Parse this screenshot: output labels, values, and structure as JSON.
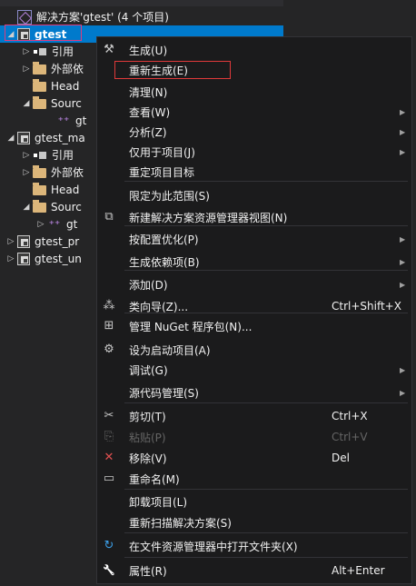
{
  "solution_explorer": {
    "solution": "解决方案'gtest' (4 个项目)",
    "nodes": [
      {
        "label": "gtest",
        "expander": "◢",
        "icon": "project-icon",
        "selected": true
      },
      {
        "label": "引用",
        "expander": "▷",
        "icon": "references-icon"
      },
      {
        "label": "外部依",
        "expander": "▷",
        "icon": "folder-icon"
      },
      {
        "label": "Head",
        "expander": "",
        "icon": "folder-icon"
      },
      {
        "label": "Sourc",
        "expander": "◢",
        "icon": "folder-icon"
      },
      {
        "label": "gt",
        "expander": "",
        "icon": "cpp-file-icon"
      },
      {
        "label": "gtest_ma",
        "expander": "◢",
        "icon": "project-icon"
      },
      {
        "label": "引用",
        "expander": "▷",
        "icon": "references-icon"
      },
      {
        "label": "外部依",
        "expander": "▷",
        "icon": "folder-icon"
      },
      {
        "label": "Head",
        "expander": "",
        "icon": "folder-icon"
      },
      {
        "label": "Sourc",
        "expander": "◢",
        "icon": "folder-icon"
      },
      {
        "label": "gt",
        "expander": "▷",
        "icon": "cpp-file-icon"
      },
      {
        "label": "gtest_pr",
        "expander": "▷",
        "icon": "project-icon"
      },
      {
        "label": "gtest_un",
        "expander": "▷",
        "icon": "project-icon"
      }
    ]
  },
  "context_menu": {
    "items": [
      {
        "label": "生成(U)",
        "icon": "build-icon",
        "shortcut": "",
        "submenu": false
      },
      {
        "label": "重新生成(E)",
        "icon": "",
        "shortcut": "",
        "submenu": false,
        "highlighted": true
      },
      {
        "label": "清理(N)",
        "icon": "",
        "shortcut": "",
        "submenu": false
      },
      {
        "label": "查看(W)",
        "icon": "",
        "shortcut": "",
        "submenu": true
      },
      {
        "label": "分析(Z)",
        "icon": "",
        "shortcut": "",
        "submenu": true
      },
      {
        "label": "仅用于项目(J)",
        "icon": "",
        "shortcut": "",
        "submenu": true
      },
      {
        "label": "重定项目目标",
        "icon": "",
        "shortcut": "",
        "submenu": false
      },
      {
        "label": "限定为此范围(S)",
        "icon": "",
        "shortcut": "",
        "submenu": false
      },
      {
        "label": "新建解决方案资源管理器视图(N)",
        "icon": "new-view-icon",
        "shortcut": "",
        "submenu": false
      },
      {
        "label": "按配置优化(P)",
        "icon": "",
        "shortcut": "",
        "submenu": true
      },
      {
        "label": "生成依赖项(B)",
        "icon": "",
        "shortcut": "",
        "submenu": true
      },
      {
        "label": "添加(D)",
        "icon": "",
        "shortcut": "",
        "submenu": true
      },
      {
        "label": "类向导(Z)...",
        "icon": "class-wizard-icon",
        "shortcut": "Ctrl+Shift+X",
        "submenu": false
      },
      {
        "label": "管理 NuGet 程序包(N)...",
        "icon": "nuget-icon",
        "shortcut": "",
        "submenu": false
      },
      {
        "label": "设为启动项目(A)",
        "icon": "gear-icon",
        "shortcut": "",
        "submenu": false
      },
      {
        "label": "调试(G)",
        "icon": "",
        "shortcut": "",
        "submenu": true
      },
      {
        "label": "源代码管理(S)",
        "icon": "",
        "shortcut": "",
        "submenu": true
      },
      {
        "label": "剪切(T)",
        "icon": "cut-icon",
        "shortcut": "Ctrl+X",
        "submenu": false
      },
      {
        "label": "粘贴(P)",
        "icon": "paste-icon",
        "shortcut": "Ctrl+V",
        "submenu": false,
        "disabled": true
      },
      {
        "label": "移除(V)",
        "icon": "remove-icon",
        "shortcut": "Del",
        "submenu": false
      },
      {
        "label": "重命名(M)",
        "icon": "rename-icon",
        "shortcut": "",
        "submenu": false
      },
      {
        "label": "卸载项目(L)",
        "icon": "",
        "shortcut": "",
        "submenu": false
      },
      {
        "label": "重新扫描解决方案(S)",
        "icon": "",
        "shortcut": "",
        "submenu": false
      },
      {
        "label": "在文件资源管理器中打开文件夹(X)",
        "icon": "refresh-icon",
        "shortcut": "",
        "submenu": false
      },
      {
        "label": "属性(R)",
        "icon": "wrench-icon",
        "shortcut": "Alt+Enter",
        "submenu": false
      }
    ]
  },
  "colors": {
    "background": "#252526",
    "selection": "#007acc",
    "menu_background": "#1b1b1c",
    "highlight_border": "#e03a3a",
    "remove_icon": "#e05050",
    "refresh_icon": "#3c9fe8"
  }
}
